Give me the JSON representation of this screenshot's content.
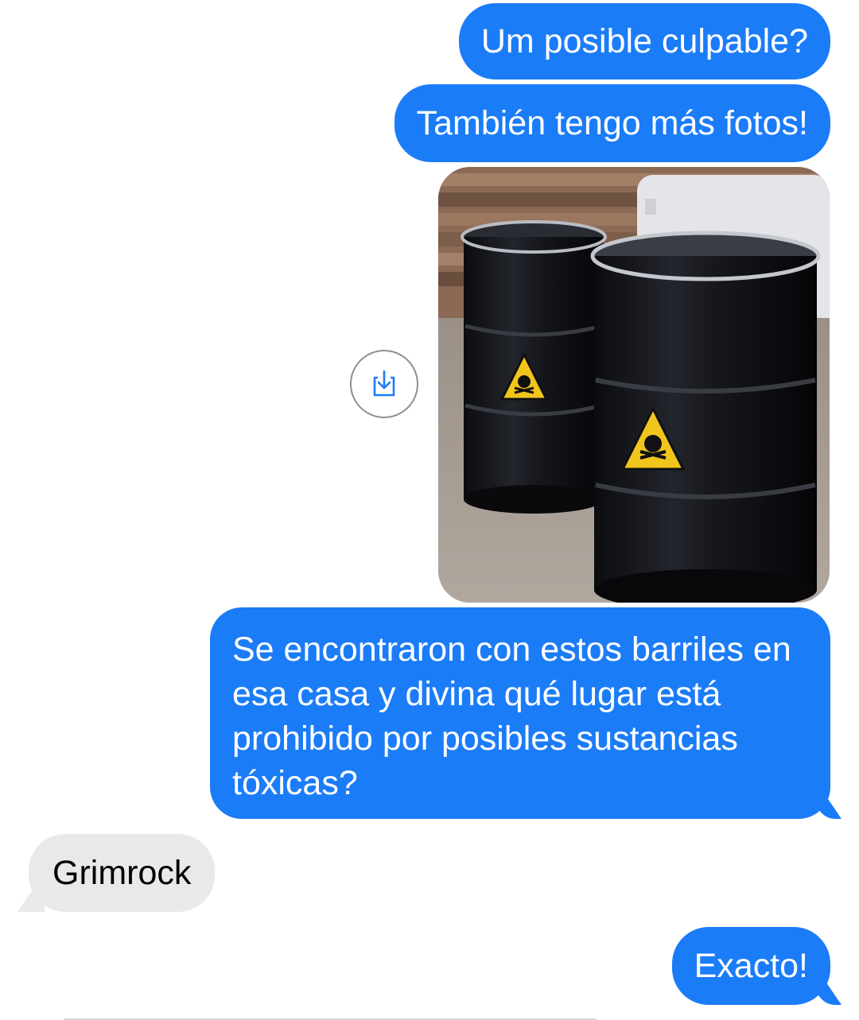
{
  "conversation": {
    "messages": [
      {
        "side": "sent",
        "text": "Um posible culpable?"
      },
      {
        "side": "sent",
        "text": "También tengo más fotos!"
      },
      {
        "side": "sent",
        "type": "image",
        "image_description_icon": "toxic-barrels-photo"
      },
      {
        "side": "sent",
        "text": "Se encontraron con estos barriles en esa casa y divina qué lugar está prohibido por posibles sustancias tóxicas?"
      },
      {
        "side": "received",
        "text": "Grimrock"
      },
      {
        "side": "sent",
        "text": "Exacto!"
      }
    ]
  },
  "icons": {
    "download": "download-icon"
  },
  "colors": {
    "sent_bubble": "#1b7cf8",
    "received_bubble": "#e9e9ec",
    "download_icon": "#1b7cf8"
  }
}
